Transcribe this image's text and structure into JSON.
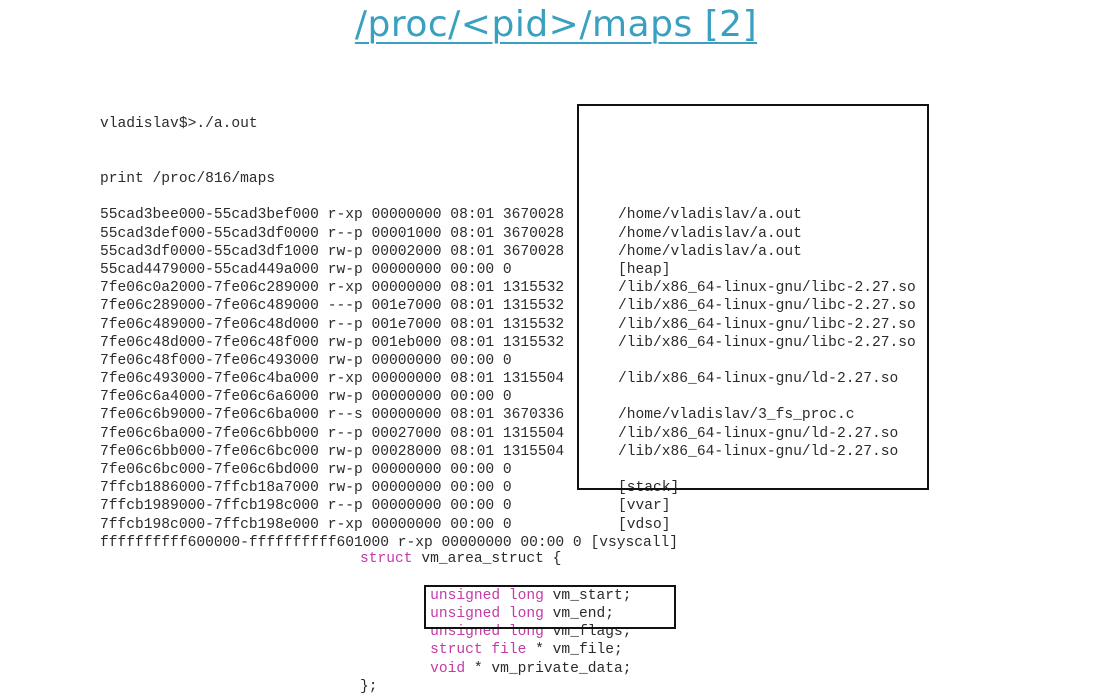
{
  "title": "/proc/<pid>/maps [2]",
  "terminal": {
    "command": "vladislav$>./a.out",
    "print_line": "print /proc/816/maps",
    "rows": [
      {
        "addr": "55cad3bee000-55cad3bef000",
        "perm": "r-xp",
        "offset": "00000000",
        "dev": "08:01",
        "inode": "3670028",
        "path": "/home/vladislav/a.out"
      },
      {
        "addr": "55cad3def000-55cad3df0000",
        "perm": "r--p",
        "offset": "00001000",
        "dev": "08:01",
        "inode": "3670028",
        "path": "/home/vladislav/a.out"
      },
      {
        "addr": "55cad3df0000-55cad3df1000",
        "perm": "rw-p",
        "offset": "00002000",
        "dev": "08:01",
        "inode": "3670028",
        "path": "/home/vladislav/a.out"
      },
      {
        "addr": "55cad4479000-55cad449a000",
        "perm": "rw-p",
        "offset": "00000000",
        "dev": "00:00",
        "inode": "0",
        "path": "[heap]"
      },
      {
        "addr": "7fe06c0a2000-7fe06c289000",
        "perm": "r-xp",
        "offset": "00000000",
        "dev": "08:01",
        "inode": "1315532",
        "path": "/lib/x86_64-linux-gnu/libc-2.27.so"
      },
      {
        "addr": "7fe06c289000-7fe06c489000",
        "perm": "---p",
        "offset": "001e7000",
        "dev": "08:01",
        "inode": "1315532",
        "path": "/lib/x86_64-linux-gnu/libc-2.27.so"
      },
      {
        "addr": "7fe06c489000-7fe06c48d000",
        "perm": "r--p",
        "offset": "001e7000",
        "dev": "08:01",
        "inode": "1315532",
        "path": "/lib/x86_64-linux-gnu/libc-2.27.so"
      },
      {
        "addr": "7fe06c48d000-7fe06c48f000",
        "perm": "rw-p",
        "offset": "001eb000",
        "dev": "08:01",
        "inode": "1315532",
        "path": "/lib/x86_64-linux-gnu/libc-2.27.so"
      },
      {
        "addr": "7fe06c48f000-7fe06c493000",
        "perm": "rw-p",
        "offset": "00000000",
        "dev": "00:00",
        "inode": "0",
        "path": ""
      },
      {
        "addr": "7fe06c493000-7fe06c4ba000",
        "perm": "r-xp",
        "offset": "00000000",
        "dev": "08:01",
        "inode": "1315504",
        "path": "/lib/x86_64-linux-gnu/ld-2.27.so"
      },
      {
        "addr": "7fe06c6a4000-7fe06c6a6000",
        "perm": "rw-p",
        "offset": "00000000",
        "dev": "00:00",
        "inode": "0",
        "path": ""
      },
      {
        "addr": "7fe06c6b9000-7fe06c6ba000",
        "perm": "r--s",
        "offset": "00000000",
        "dev": "08:01",
        "inode": "3670336",
        "path": "/home/vladislav/3_fs_proc.c"
      },
      {
        "addr": "7fe06c6ba000-7fe06c6bb000",
        "perm": "r--p",
        "offset": "00027000",
        "dev": "08:01",
        "inode": "1315504",
        "path": "/lib/x86_64-linux-gnu/ld-2.27.so"
      },
      {
        "addr": "7fe06c6bb000-7fe06c6bc000",
        "perm": "rw-p",
        "offset": "00028000",
        "dev": "08:01",
        "inode": "1315504",
        "path": "/lib/x86_64-linux-gnu/ld-2.27.so"
      },
      {
        "addr": "7fe06c6bc000-7fe06c6bd000",
        "perm": "rw-p",
        "offset": "00000000",
        "dev": "00:00",
        "inode": "0",
        "path": ""
      },
      {
        "addr": "7ffcb1886000-7ffcb18a7000",
        "perm": "rw-p",
        "offset": "00000000",
        "dev": "00:00",
        "inode": "0",
        "path": "[stack]"
      },
      {
        "addr": "7ffcb1989000-7ffcb198c000",
        "perm": "r--p",
        "offset": "00000000",
        "dev": "00:00",
        "inode": "0",
        "path": "[vvar]"
      },
      {
        "addr": "7ffcb198c000-7ffcb198e000",
        "perm": "r-xp",
        "offset": "00000000",
        "dev": "00:00",
        "inode": "0",
        "path": "[vdso]"
      }
    ],
    "last_row_prefix": "ffffffffff600000-ffffffffff601000 r-xp 00000000 00:00 0",
    "last_row_path": "[vsyscall]"
  },
  "struct": {
    "open_kw": "struct",
    "open_name": "vm_area_struct {",
    "fields": [
      {
        "type": "unsigned long",
        "rest": " vm_start;"
      },
      {
        "type": "unsigned long",
        "rest": " vm_end;"
      },
      {
        "type": "unsigned long",
        "rest": " vm_flags;"
      },
      {
        "type": "struct file",
        "rest": " * vm_file;"
      },
      {
        "type": "void",
        "rest": " * vm_private_data;"
      }
    ],
    "close": "};"
  },
  "colors": {
    "title": "#3aa0c0",
    "keyword": "#c43aa8",
    "text": "#2b2b2b",
    "box_border": "#111111"
  }
}
